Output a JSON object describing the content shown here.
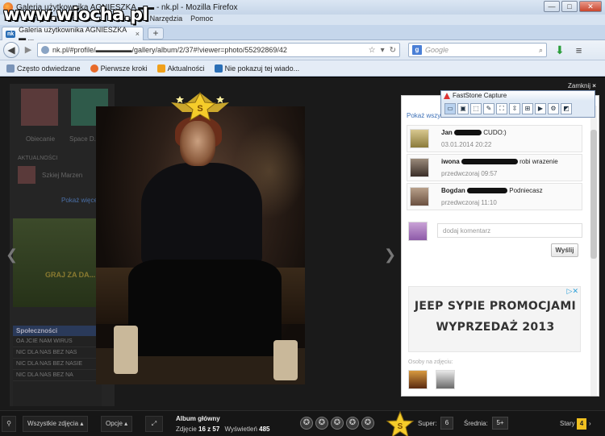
{
  "watermark": "www.wiocha.pl",
  "window": {
    "title": "Galeria użytkownika AGNIESZKA ▬▬ - nk.pl - Mozilla Firefox",
    "buttons": [
      "—",
      "□",
      "✕"
    ]
  },
  "menubar": [
    "Plik",
    "Edycja",
    "Widok",
    "Historia",
    "Zakładki",
    "Narzędzia",
    "Pomoc"
  ],
  "tab": {
    "label": "Galeria użytkownika AGNIESZKA ▬ ...",
    "close": "×",
    "new_tab": "+"
  },
  "navbar": {
    "url": "nk.pl/#profile/▬▬▬▬▬/gallery/album/2/37#!viewer=photo/55292869/42",
    "search_placeholder": "Google",
    "search_engine": "g"
  },
  "bookmarks": [
    "Często odwiedzane",
    "Pierwsze kroki",
    "Aktualności",
    "Nie pokazuj tej wiado..."
  ],
  "background_page": {
    "profile_label": "Obiecanie",
    "space_label": "Space D...",
    "section_label": "AKTUALNOŚCI",
    "saved_label": "Szkiej Marzen",
    "link_label": "Pokaż więcej",
    "ad_label": "GRAJ ZA DA...",
    "list_header": "Społeczności",
    "list_items": [
      "OA JCIE NAM WIRUS",
      "NIC DLA NAS BEZ NAS",
      "NIC DLA NAS BEZ NASIE",
      "NIC DLA NAS BEZ NA"
    ]
  },
  "viewer": {
    "close_label": "Zamknij",
    "close_icon": "×",
    "panel_link": "Pokaż wszystkie",
    "comments": [
      {
        "name": "Jan",
        "text": "CUDO:)",
        "date": "03.01.2014 20:22"
      },
      {
        "name": "iwona",
        "text": "robi wrazenie",
        "date": "przedwczoraj 09:57"
      },
      {
        "name": "Bogdan",
        "text": "Podniecasz",
        "date": "przedwczoraj 11:10"
      }
    ],
    "add_comment_placeholder": "dodaj komentarz",
    "send_button": "Wyślij",
    "ad_line1": "JEEP SYPIE PROMOCJAMI",
    "ad_line2": "WYPRZEDAŻ 2013",
    "people_label": "Osoby na zdjęciu:"
  },
  "faststone": {
    "title": "FastStone Capture"
  },
  "bottombar": {
    "filter_label": "Wszystkie zdjęcia",
    "options_label": "Opcje",
    "album_title": "Album główny",
    "photo_label": "Zdjęcie",
    "photo_position": "16 z 57",
    "views_label": "Wyświetleń",
    "views_count": "485",
    "super_label": "Super:",
    "super_count": "6",
    "average_label": "Średnia:",
    "average_value": "5+",
    "stars_label": "Stary",
    "stars_count": "4"
  },
  "colors": {
    "accent": "#f0c020",
    "link": "#3b6fb6",
    "nk_blue": "#2b6fb6"
  }
}
